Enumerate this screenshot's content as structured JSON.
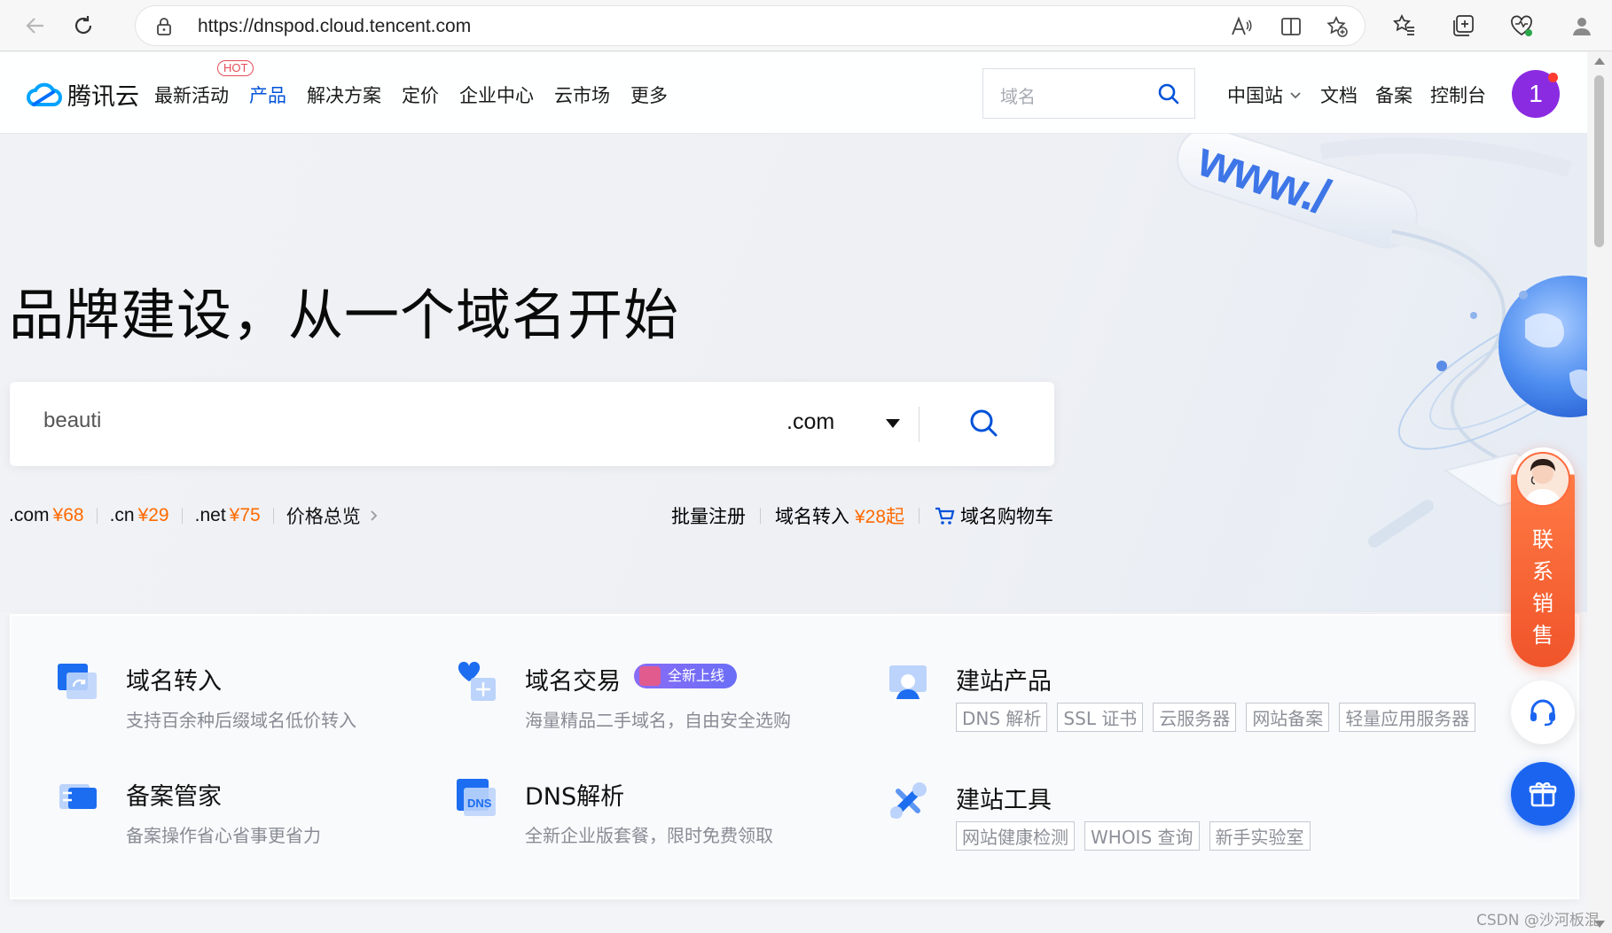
{
  "browser": {
    "url": "https://dnspod.cloud.tencent.com"
  },
  "header": {
    "logo_text": "腾讯云",
    "nav": [
      {
        "label": "最新活动"
      },
      {
        "label": "产品"
      },
      {
        "label": "解决方案"
      },
      {
        "label": "定价"
      },
      {
        "label": "企业中心"
      },
      {
        "label": "云市场"
      },
      {
        "label": "更多"
      }
    ],
    "hot_badge": "HOT",
    "search_placeholder": "域名",
    "right_nav": [
      {
        "label": "中国站"
      },
      {
        "label": "文档"
      },
      {
        "label": "备案"
      },
      {
        "label": "控制台"
      }
    ],
    "avatar_text": "1"
  },
  "hero": {
    "title": "品牌建设，从一个域名开始",
    "search_value": "beauti",
    "tld_selected": ".com",
    "prices": [
      {
        "tld": ".com",
        "price": "¥68"
      },
      {
        "tld": ".cn",
        "price": "¥29"
      },
      {
        "tld": ".net",
        "price": "¥75"
      }
    ],
    "price_overview": "价格总览",
    "bulk_register": "批量注册",
    "transfer": "域名转入",
    "transfer_price": "¥28起",
    "cart": "域名购物车"
  },
  "products": {
    "transfer": {
      "title": "域名转入",
      "desc": "支持百余种后缀域名低价转入"
    },
    "trade": {
      "title": "域名交易",
      "badge": "全新上线",
      "desc": "海量精品二手域名，自由安全选购"
    },
    "site_products": {
      "title": "建站产品",
      "tags": [
        "DNS 解析",
        "SSL 证书",
        "云服务器",
        "网站备案",
        "轻量应用服务器"
      ]
    },
    "icp": {
      "title": "备案管家",
      "desc": "备案操作省心省事更省力"
    },
    "dns": {
      "title": "DNS解析",
      "desc": "全新企业版套餐，限时免费领取"
    },
    "site_tools": {
      "title": "建站工具",
      "tags": [
        "网站健康检测",
        "WHOIS 查询",
        "新手实验室"
      ]
    }
  },
  "float": {
    "sales_text": "联系销售"
  },
  "watermark": "CSDN @沙河板混",
  "colors": {
    "brand_blue": "#0052d9",
    "price_orange": "#ff6a00",
    "sales_orange": "#f0542a",
    "avatar_purple": "#8a2be2"
  }
}
